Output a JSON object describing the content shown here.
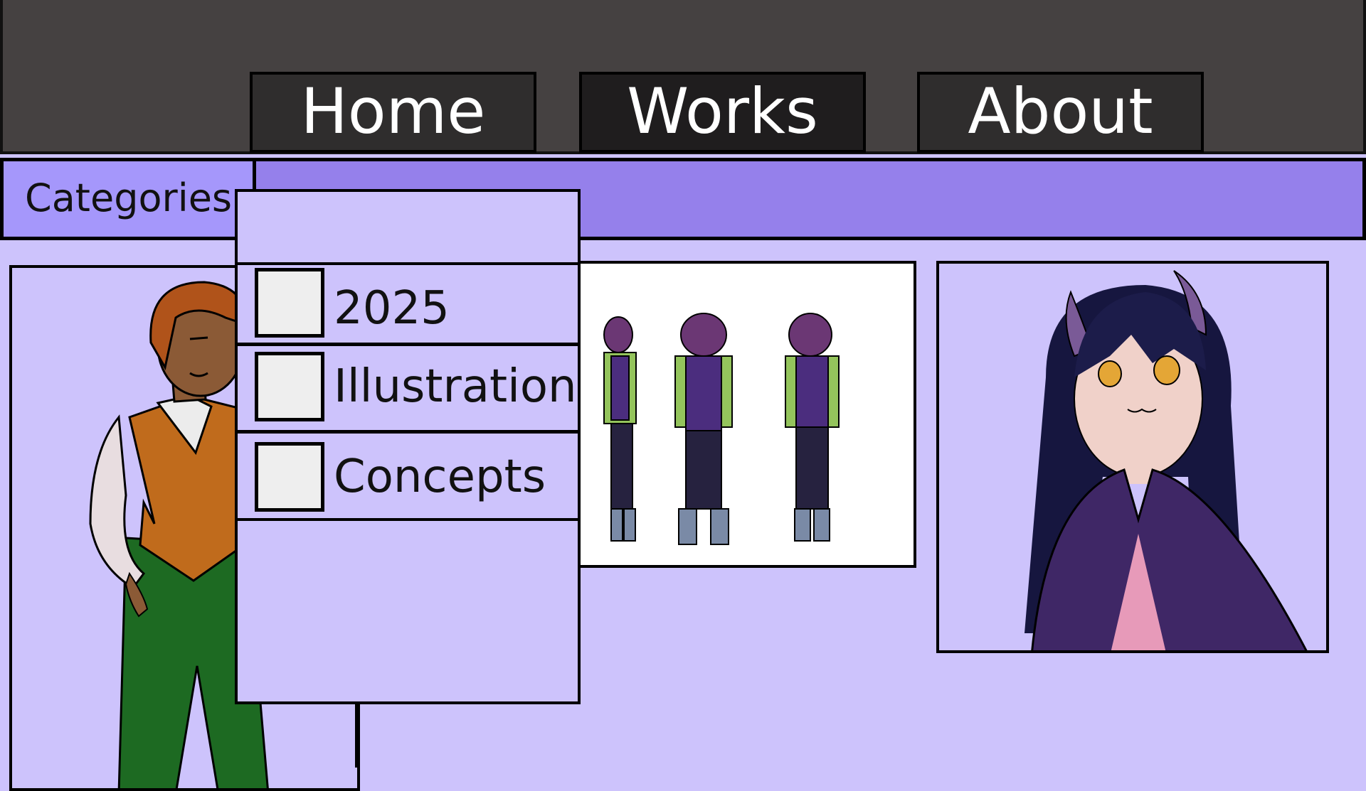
{
  "nav": {
    "items": [
      {
        "label": "Home"
      },
      {
        "label": "Works",
        "active": true
      },
      {
        "label": "About"
      }
    ]
  },
  "categories": {
    "label": "Categories",
    "options": [
      {
        "label": "2025",
        "checked": false
      },
      {
        "label": "Illustration",
        "checked": false
      },
      {
        "label": "Concepts",
        "checked": false
      }
    ]
  },
  "gallery": {
    "items": [
      {
        "subject": "character-illustration-man-orange-vest"
      },
      {
        "subject": "character-turnaround-sheet"
      },
      {
        "subject": "character-portrait-horned-girl-purple-cloak"
      }
    ]
  },
  "colors": {
    "topbar": "#454141",
    "nav_button": "#2f2d2d",
    "nav_button_active": "#1f1d1e",
    "category_bar": "#9580eb",
    "category_label_bg": "#a597fb",
    "page_bg": "#cdc3fc",
    "checkbox": "#eeeeee"
  }
}
